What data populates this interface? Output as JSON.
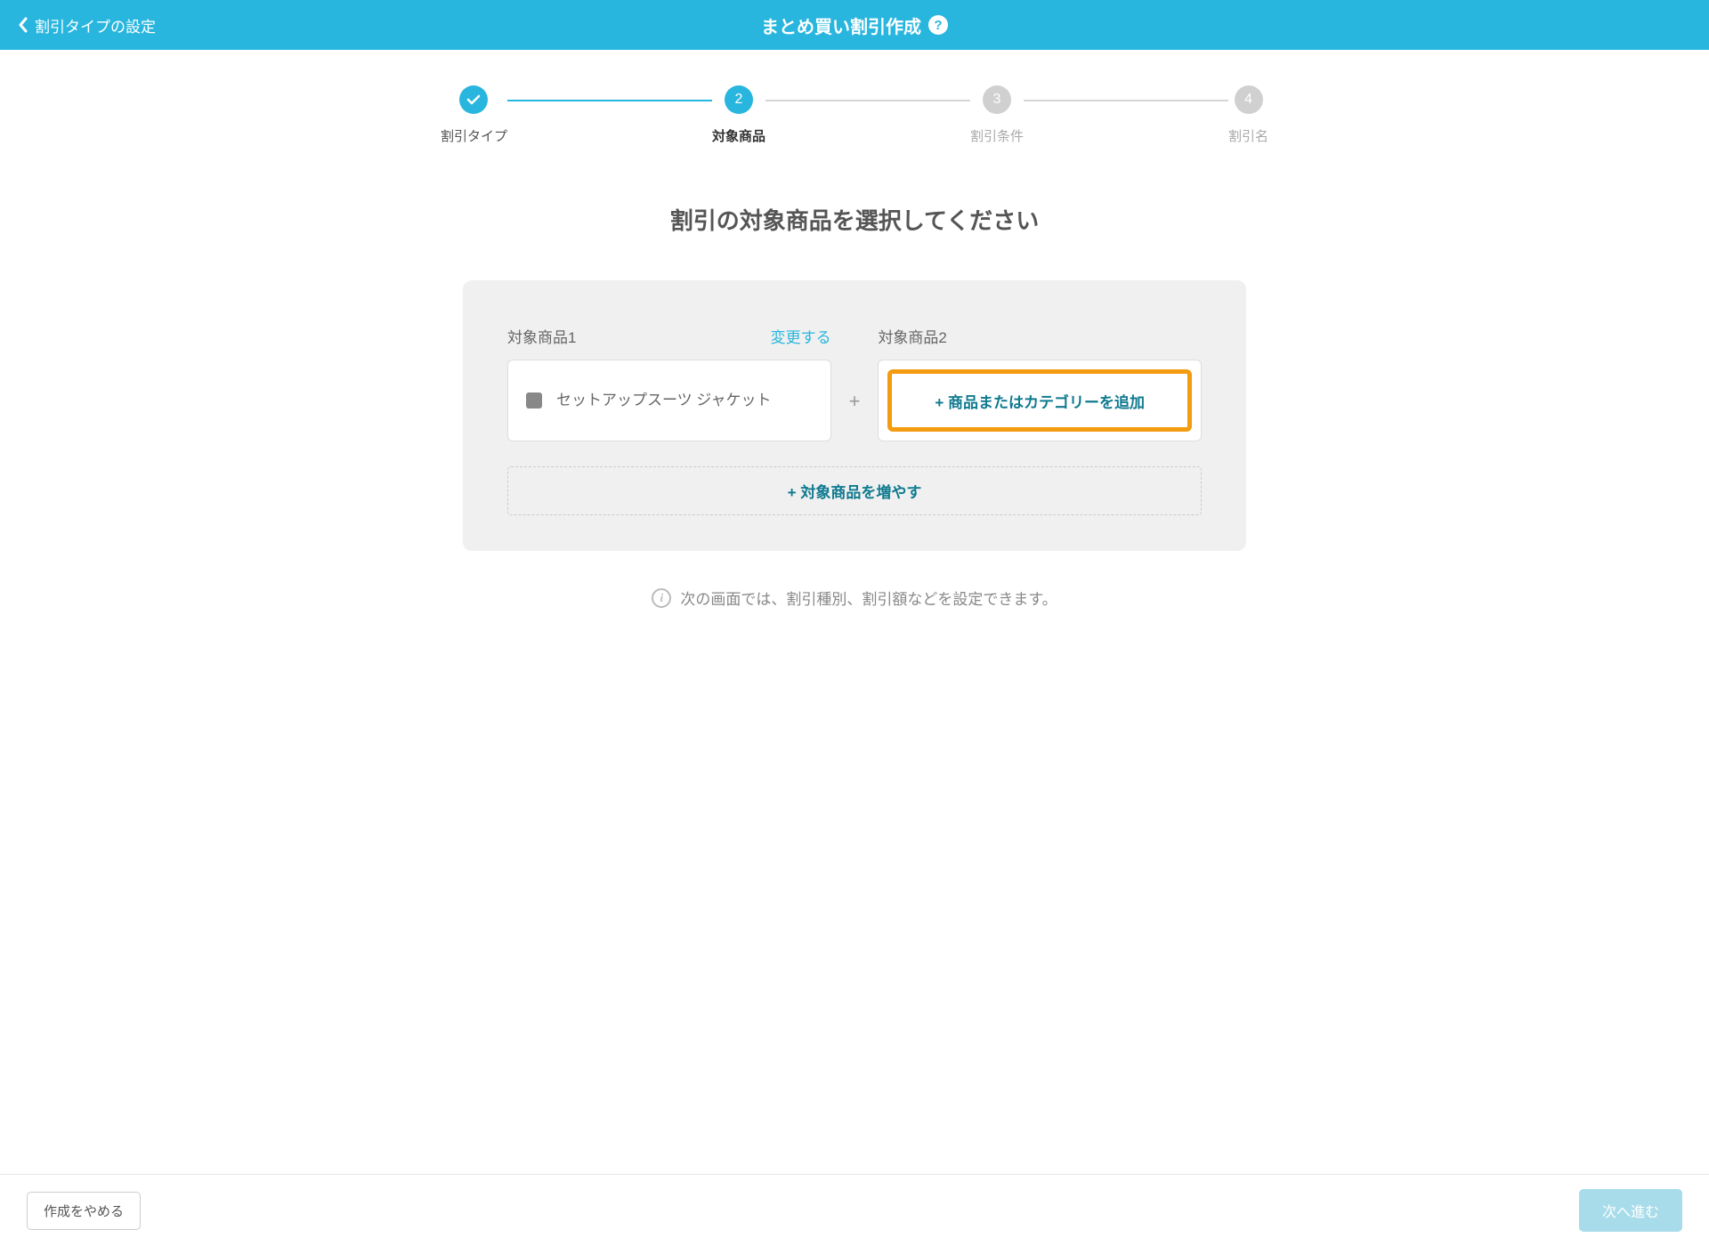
{
  "header": {
    "back_label": "割引タイプの設定",
    "title": "まとめ買い割引作成"
  },
  "stepper": {
    "steps": [
      {
        "label": "割引タイプ",
        "state": "done"
      },
      {
        "label": "対象商品",
        "state": "active",
        "num": "2"
      },
      {
        "label": "割引条件",
        "state": "pending",
        "num": "3"
      },
      {
        "label": "割引名",
        "state": "pending",
        "num": "4"
      }
    ]
  },
  "page_title": "割引の対象商品を選択してください",
  "product1": {
    "label": "対象商品1",
    "change": "変更する",
    "name": "セットアップスーツ ジャケット"
  },
  "product2": {
    "label": "対象商品2",
    "add_button": "+ 商品またはカテゴリーを追加"
  },
  "plus": "+",
  "add_more": "+ 対象商品を増やす",
  "info_text": "次の画面では、割引種別、割引額などを設定できます。",
  "footer": {
    "cancel": "作成をやめる",
    "next": "次へ進む"
  }
}
